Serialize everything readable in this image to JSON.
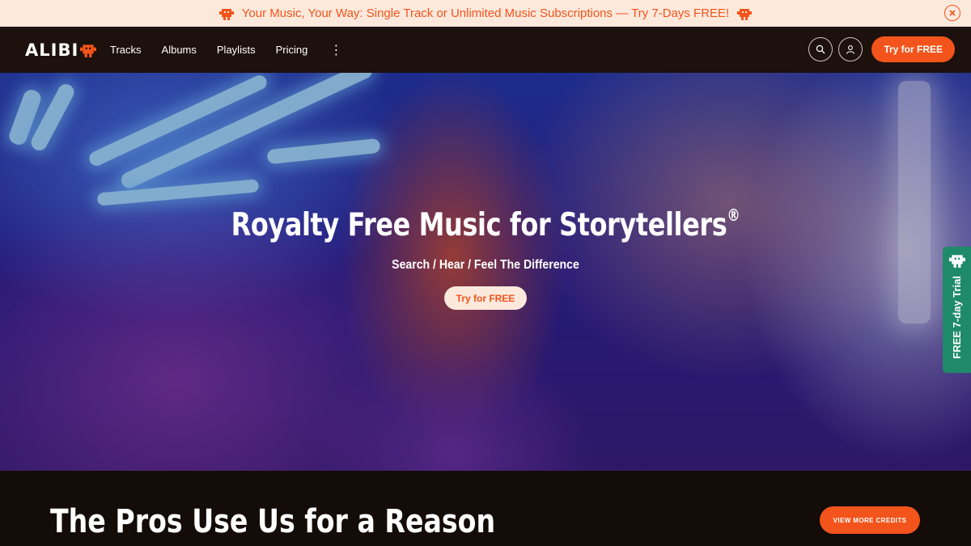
{
  "promo": {
    "text": "Your Music, Your Way: Single Track or Unlimited Music Subscriptions — Try 7-Days FREE!",
    "close_icon": "close-icon"
  },
  "header": {
    "logo_text": "ALIBI",
    "nav": {
      "tracks": "Tracks",
      "albums": "Albums",
      "playlists": "Playlists",
      "pricing": "Pricing",
      "more": "⋮"
    },
    "cta_label": "Try for FREE"
  },
  "hero": {
    "title": "Royalty Free Music for Storytellers",
    "title_mark": "®",
    "subtitle": "Search / Hear / Feel The Difference",
    "cta_label": "Try for FREE"
  },
  "side_tab": {
    "label": "FREE 7-day Trial"
  },
  "credits": {
    "title": "The Pros Use Us for a Reason",
    "button_label": "VIEW MORE CREDITS"
  },
  "colors": {
    "accent": "#f2541b",
    "promo_bg": "#fde9dc",
    "header_bg": "#1c110c",
    "side_tab_bg": "#1f8a6a"
  }
}
